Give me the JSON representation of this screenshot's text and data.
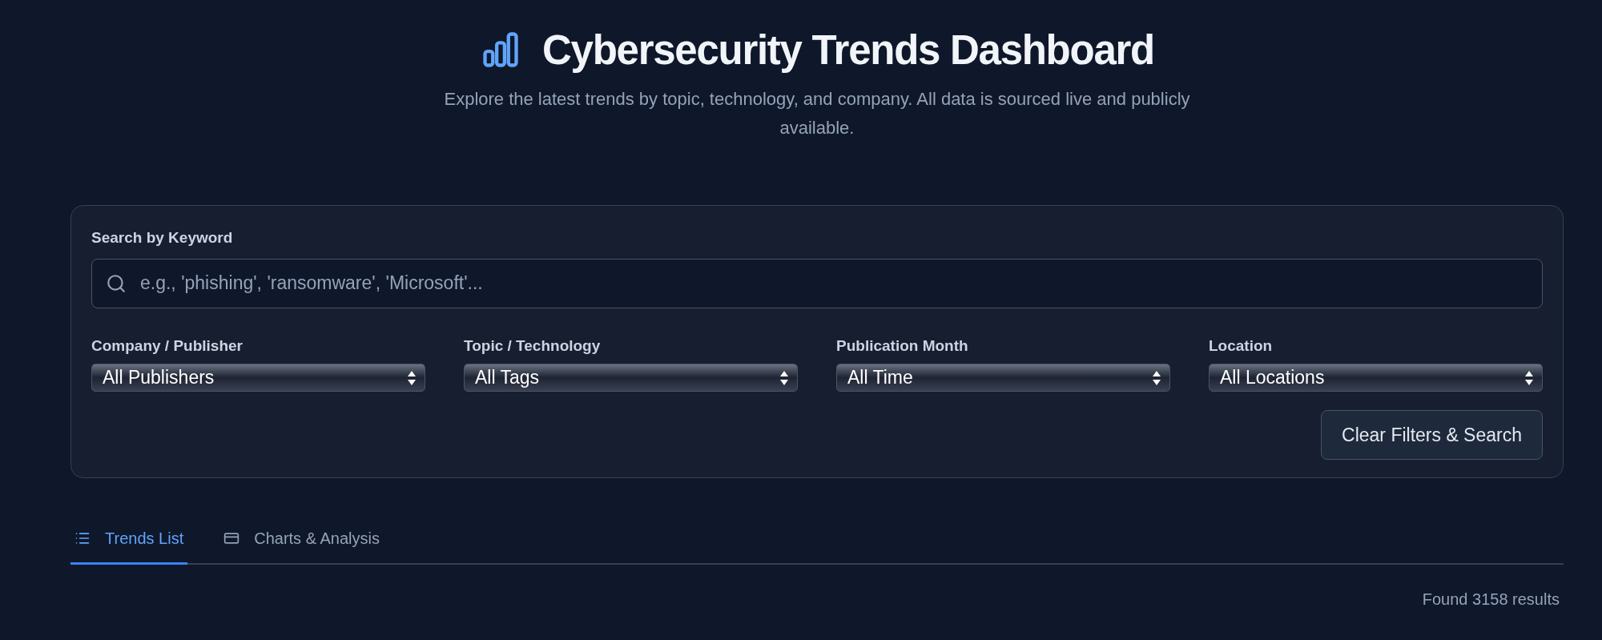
{
  "header": {
    "title": "Cybersecurity Trends Dashboard",
    "subtitle": "Explore the latest trends by topic, technology, and company. All data is sourced live and publicly available."
  },
  "filters": {
    "search": {
      "label": "Search by Keyword",
      "placeholder": "e.g., 'phishing', 'ransomware', 'Microsoft'..."
    },
    "selects": [
      {
        "label": "Company / Publisher",
        "value": "All Publishers"
      },
      {
        "label": "Topic / Technology",
        "value": "All Tags"
      },
      {
        "label": "Publication Month",
        "value": "All Time"
      },
      {
        "label": "Location",
        "value": "All Locations"
      }
    ],
    "clear_button": "Clear Filters & Search"
  },
  "tabs": [
    {
      "label": "Trends List",
      "kind": "list",
      "selected": true
    },
    {
      "label": "Charts & Analysis",
      "kind": "charts",
      "selected": false
    }
  ],
  "results_count": "Found 3158 results"
}
